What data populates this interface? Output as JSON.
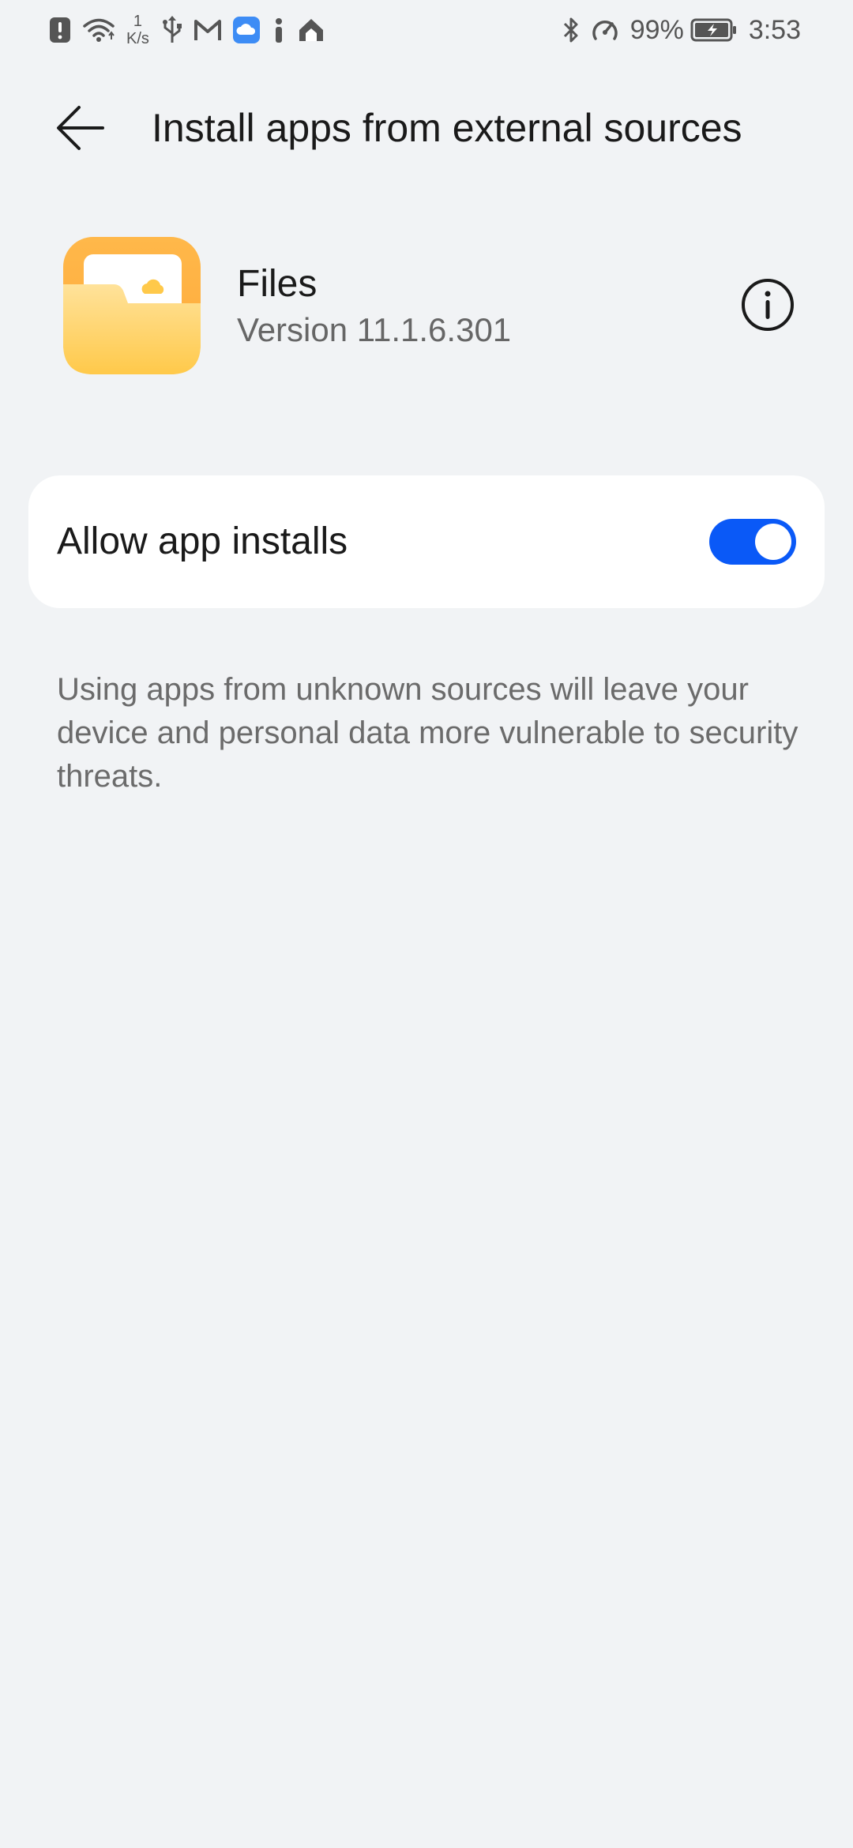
{
  "status_bar": {
    "net_speed_value": "1",
    "net_speed_unit": "K/s",
    "battery_percent": "99%",
    "time": "3:53",
    "icons": [
      "alert-icon",
      "wifi-icon",
      "usb-icon",
      "gmail-icon",
      "cloud-app-icon",
      "info-app-icon",
      "home-app-icon",
      "bluetooth-icon",
      "speedometer-icon",
      "battery-charging-icon"
    ]
  },
  "header": {
    "title": "Install apps from external sources",
    "back_icon": "arrow-left-icon"
  },
  "app": {
    "name": "Files",
    "version": "Version 11.1.6.301",
    "icon": "files-folder-icon",
    "info_icon": "info-circle-icon"
  },
  "setting": {
    "label": "Allow app installs",
    "enabled": true
  },
  "warning_text": "Using apps from unknown sources will leave your device and personal data more vulnerable to security threats.",
  "colors": {
    "background": "#f1f3f5",
    "card": "#ffffff",
    "accent": "#0a59f7",
    "folder_primary": "#ffc94a"
  }
}
